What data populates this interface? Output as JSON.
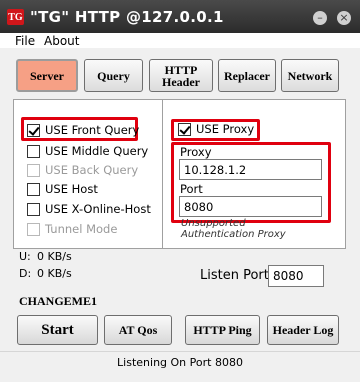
{
  "window": {
    "icon_text": "TG",
    "title": "\"TG\" HTTP @127.0.0.1",
    "minimize": "–",
    "close": "×"
  },
  "menu": [
    "File",
    "About"
  ],
  "tabs": [
    {
      "label": "Server",
      "active": true
    },
    {
      "label": "Query",
      "active": false
    },
    {
      "label": "HTTP\nHeader",
      "active": false
    },
    {
      "label": "Replacer",
      "active": false
    },
    {
      "label": "Network",
      "active": false
    }
  ],
  "options": [
    {
      "label": "USE Front Query",
      "checked": true,
      "enabled": true
    },
    {
      "label": "USE Middle Query",
      "checked": false,
      "enabled": true
    },
    {
      "label": "USE Back Query",
      "checked": false,
      "enabled": false
    },
    {
      "label": "USE Host",
      "checked": false,
      "enabled": true
    },
    {
      "label": "USE X-Online-Host",
      "checked": false,
      "enabled": true
    },
    {
      "label": "Tunnel Mode",
      "checked": false,
      "enabled": false
    }
  ],
  "proxy": {
    "use_proxy_label": "USE Proxy",
    "use_proxy_checked": true,
    "proxy_label": "Proxy",
    "proxy_value": "10.128.1.2",
    "port_label": "Port",
    "port_value": "8080",
    "auth_note": "Unsupported Authentication Proxy"
  },
  "stats": {
    "upload_label": "U:",
    "upload_value": "0 KB/s",
    "download_label": "D:",
    "download_value": "0 KB/s"
  },
  "listen": {
    "label": "Listen Port",
    "value": "8080"
  },
  "host_name": "CHANGEME1",
  "actions": [
    "Start",
    "AT Qos",
    "HTTP Ping",
    "Header Log"
  ],
  "status": "Listening On Port 8080",
  "colors": {
    "highlight": "#e0000f",
    "active_tab": "#f6a085",
    "titlebar": "#2b2b2b"
  }
}
